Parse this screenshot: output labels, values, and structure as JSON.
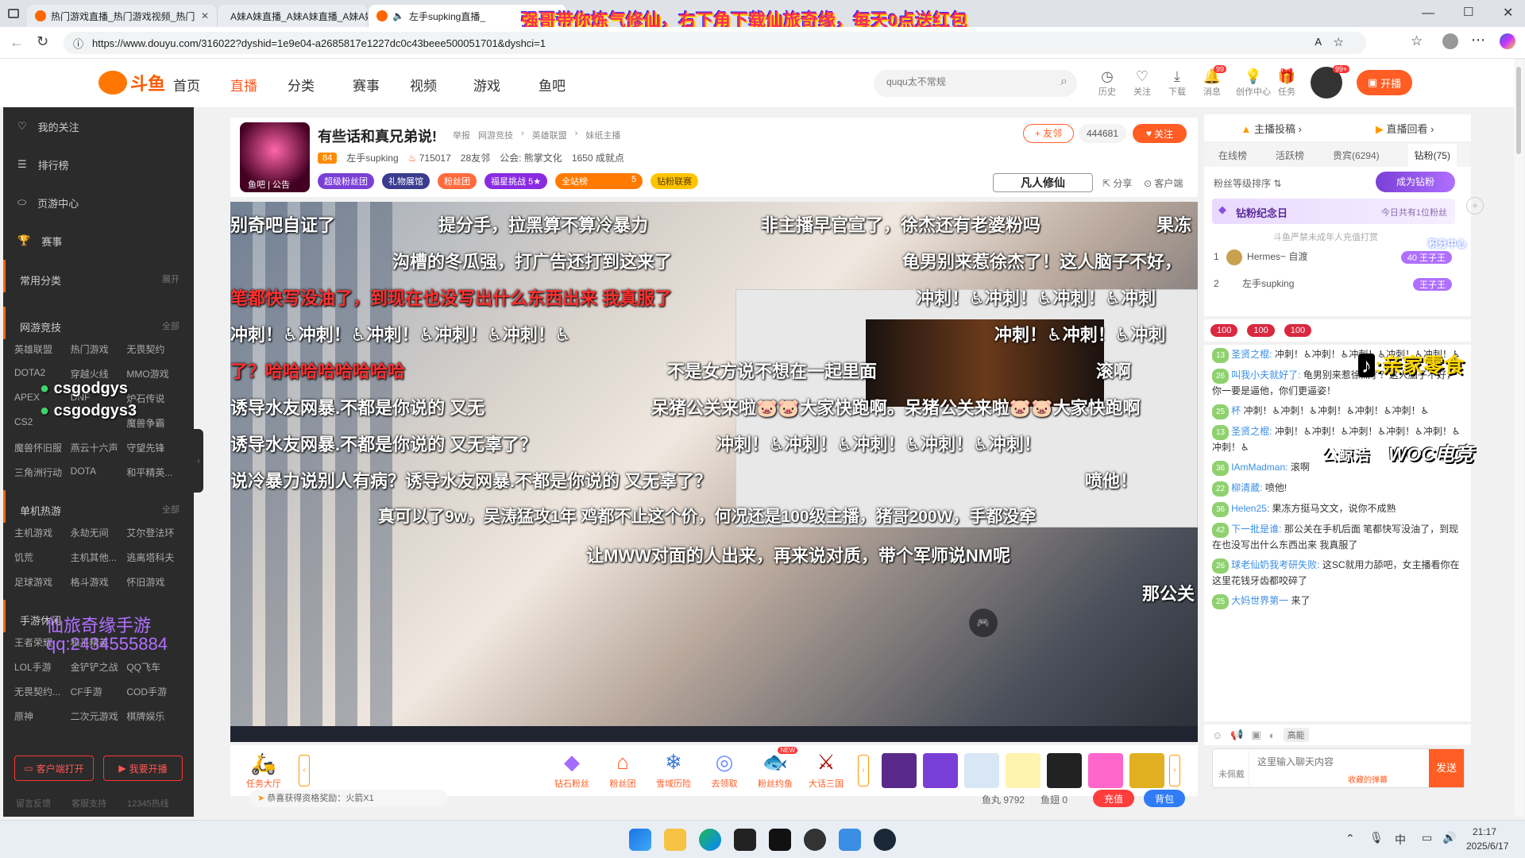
{
  "tabs": [
    {
      "title": "热门游戏直播_热门游戏视频_热门"
    },
    {
      "title": "A妹A妹直播_A妹A妹直播_A妹A妹"
    },
    {
      "title": "左手supking直播_"
    }
  ],
  "overlay_top": "强哥带你炼气修仙，右下角下载仙旅奇缘，每天0点送红包",
  "address": {
    "url": "https://www.douyu.com/316022?dyshid=1e9e04-a2685817e1227dc0c43beee500051701&dyshci=1"
  },
  "nav": {
    "logo": "斗鱼",
    "items": [
      "首页",
      "直播",
      "分类",
      "赛事",
      "视频",
      "游戏",
      "鱼吧"
    ],
    "search_placeholder": "ququ太不常规",
    "right": [
      "历史",
      "关注",
      "下载",
      "消息",
      "创作中心",
      "任务"
    ],
    "msg_count": "99",
    "avatar_badge": "99+",
    "open_live": "开播"
  },
  "sidebar": {
    "main": [
      "我的关注",
      "排行榜",
      "页游中心",
      "赛事"
    ],
    "common": "常用分类",
    "common_more": "展开",
    "s1": {
      "title": "网游竞技",
      "more": "全部",
      "items": [
        "英雄联盟",
        "热门游戏",
        "无畏契约",
        "DOTA2",
        "穿越火线",
        "MMO游戏",
        "APEX",
        "DNF",
        "炉石传说",
        "CS2",
        "",
        "魔兽争霸",
        "魔兽怀旧服",
        "燕云十六声",
        "守望先锋",
        "三角洲行动",
        "DOTA",
        "和平精英..."
      ]
    },
    "s2": {
      "title": "单机热游",
      "more": "全部",
      "items": [
        "主机游戏",
        "永劫无间",
        "艾尔登法环",
        "饥荒",
        "主机其他...",
        "逃离塔科夫",
        "足球游戏",
        "格斗游戏",
        "怀旧游戏"
      ]
    },
    "s3": {
      "title": "手游休闲",
      "items": [
        "王者荣耀",
        "和平精英",
        "",
        "LOL手游",
        "金铲铲之战",
        "QQ飞车",
        "无畏契约...",
        "CF手游",
        "COD手游",
        "原神",
        "二次元游戏",
        "棋牌娱乐"
      ]
    },
    "client_btn": "客户端打开",
    "live_btn": "我要开播",
    "footer": [
      "留言反馈",
      "客服支持",
      "12345热线"
    ]
  },
  "room": {
    "title": "有些话和真兄弟说!",
    "report": "举报",
    "crumbs": [
      "网游竞技",
      "英雄联盟",
      "妹纸主播"
    ],
    "host_level": "84",
    "host": "左手supking",
    "heat": "715017",
    "friends": "28友邻",
    "guild": "公会: 熊掌文化",
    "achieve": "1650 成就点",
    "tags": [
      "超级粉丝团",
      "礼物展馆",
      "粉丝团",
      "福星挑战",
      "全站榜",
      "钻粉联赛"
    ],
    "fuxing_count": "5",
    "rank_num": "5",
    "friend_btn": "+ 友邻",
    "follow_count": "444681",
    "follow_btn": "关注",
    "share": "分享",
    "client": "客户端",
    "avatar_label": "鱼吧 | 公告",
    "fanren": "凡人修仙"
  },
  "danmaku": [
    {
      "t": "别奇吧自证了",
      "c": ""
    },
    {
      "t": "提分手，拉黑算不算冷暴力",
      "c": ""
    },
    {
      "t": "非主播早官宣了，徐杰还有老婆粉吗",
      "c": ""
    },
    {
      "t": "果冻",
      "c": ""
    },
    {
      "t": "沟槽的冬瓜强，打广告还打到这来了",
      "c": ""
    },
    {
      "t": "龟男别来惹徐杰了！这人脑子不好，",
      "c": ""
    },
    {
      "t": "笔都快写没油了，到现在也没写出什么东西出来 我真服了",
      "c": "red"
    },
    {
      "t": "冲刺！♿冲刺！♿冲刺！♿冲刺",
      "c": ""
    },
    {
      "t": "冲刺！♿冲刺！♿冲刺！♿冲刺！♿冲刺！♿",
      "c": ""
    },
    {
      "t": "冲刺！♿冲刺！♿冲刺",
      "c": ""
    },
    {
      "t": "了？哈哈哈哈哈哈哈哈",
      "c": "red"
    },
    {
      "t": "不是女方说不想在一起里面",
      "c": ""
    },
    {
      "t": "滚啊",
      "c": ""
    },
    {
      "t": "诱导水友网暴.不都是你说的 又无",
      "c": ""
    },
    {
      "t": "呆猪公关来啦🐷🐷大家快跑啊。呆猪公关来啦🐷🐷大家快跑啊",
      "c": ""
    },
    {
      "t": "诱导水友网暴.不都是你说的 又无辜了？",
      "c": ""
    },
    {
      "t": "冲刺！♿冲刺！♿冲刺！♿冲刺！♿冲刺！",
      "c": ""
    },
    {
      "t": "说冷暴力说别人有病？诱导水友网暴.不都是你说的 又无辜了？",
      "c": ""
    },
    {
      "t": "喷他！",
      "c": ""
    },
    {
      "t": "真可以了9w，吴涛猛攻1年 鸡都不止这个价，何况还是100级主播，猪哥200W，手都没牵",
      "c": ""
    },
    {
      "t": "让MWW对面的人出来，再来说对质，带个军师说NM呢",
      "c": ""
    },
    {
      "t": "那公关",
      "c": ""
    }
  ],
  "overlay_wx": [
    "csgodgys",
    "csgodgys3"
  ],
  "overlay_xl": [
    "仙旅奇缘手游",
    "qq:2434555884"
  ],
  "overlay_right": [
    ":亲家零食",
    "WOC电竞",
    "公鲸浩"
  ],
  "gifts": {
    "task_hall": "任务大厅",
    "items": [
      "钻石粉丝",
      "粉丝团",
      "雪域历险",
      "去领取",
      "粉丝约鱼",
      "大话三国"
    ],
    "new_badge": "NEW"
  },
  "bottom": {
    "notice": "恭喜获得资格奖励：火箭X1",
    "yuwan_label": "鱼丸",
    "yuwan": "9792",
    "yuchi_label": "鱼翅",
    "yuchi": "0",
    "recharge": "充值",
    "bag": "背包"
  },
  "right": {
    "top_links": [
      "主播投稿",
      "直播回看"
    ],
    "tabs": [
      "在线榜",
      "活跃榜",
      "贵宾(6294)",
      "钻粉(75)"
    ],
    "sort": "粉丝等级排序",
    "become": "成为钻粉",
    "memorial": "钻粉纪念日",
    "memorial_sub": "今日共有1位粉丝",
    "notice": "斗鱼严禁未成年人充值打赏",
    "ranks": [
      {
        "n": "1",
        "name": "Hermes~ 自渡",
        "tag": "40 王子王"
      },
      {
        "n": "2",
        "name": "左手supking",
        "tag": "王子王"
      }
    ],
    "score_center": "积分中心",
    "mini_scores": [
      "100",
      "100",
      "100"
    ],
    "chats": [
      {
        "lv": "13",
        "name": "圣贤之棍:",
        "text": "冲刺！♿冲刺！♿冲刺！♿冲刺！♿冲刺！♿"
      },
      {
        "lv": "26",
        "name": "叫我小夫就好了:",
        "text": "龟男别来惹徐杰了？这人脑子不好，你一要是逼他，你们更逼姿！"
      },
      {
        "lv": "25",
        "name": "杯",
        "text": "冲刺！♿冲刺！♿冲刺！♿冲刺！♿冲刺！♿"
      },
      {
        "lv": "13",
        "name": "圣贤之棍:",
        "text": "冲刺！♿冲刺！♿冲刺！♿冲刺！♿冲刺！♿冲刺！♿"
      },
      {
        "lv": "36",
        "name": "IAmMadman:",
        "text": "滚啊"
      },
      {
        "lv": "22",
        "name": "柳清葳:",
        "text": "喷他!"
      },
      {
        "lv": "36",
        "name": "Helen25:",
        "text": "果冻方挺马文文，说你不成熟"
      },
      {
        "lv": "42",
        "name": "下一批是谁:",
        "text": "那公关在手机后面 笔都快写没油了，到现在也没写出什么东西出来 我真服了"
      },
      {
        "lv": "26",
        "name": "球老仙奶我考研失败:",
        "text": "这SC就用力舔吧，女主播看你在这里花钱牙齿都咬碎了"
      },
      {
        "lv": "25",
        "name": "大妈世界第一",
        "text": "来了"
      }
    ],
    "input_placeholder": "这里输入聊天内容",
    "collect": "收藏的弹幕",
    "unbadge": "未佩戴",
    "send": "发送",
    "hot": "高能"
  },
  "taskbar": {
    "time": "21:17",
    "date": "2025/6/17",
    "ime": "中"
  }
}
